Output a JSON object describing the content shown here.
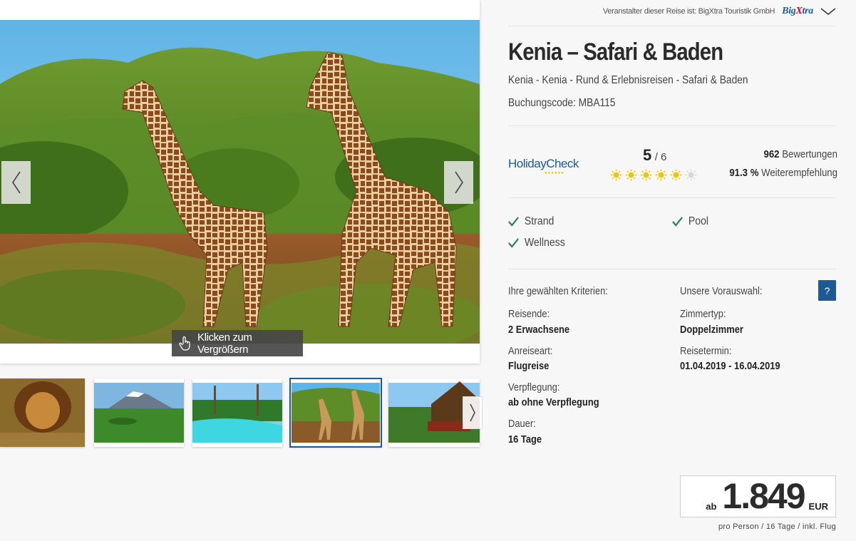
{
  "gallery": {
    "enlarge_label": "Klicken zum Vergrößern",
    "thumbnails": [
      {
        "name": "thumb-lion"
      },
      {
        "name": "thumb-kilimanjaro"
      },
      {
        "name": "thumb-pool"
      },
      {
        "name": "thumb-giraffes"
      },
      {
        "name": "thumb-lodge"
      }
    ],
    "active_thumbnail": 3
  },
  "operator": {
    "label": "Veranstalter dieser Reise ist: BigXtra Touristik GmbH",
    "logo_prefix": "Big",
    "logo_x": "X",
    "logo_suffix": "tra"
  },
  "offer": {
    "title": "Kenia – Safari & Baden",
    "breadcrumb": "Kenia - Kenia - Rund & Erlebnisreisen - Safari & Baden",
    "booking_code": "Buchungscode: MBA115"
  },
  "holidaycheck": {
    "logo_text": "HolidayCheck",
    "score": "5",
    "max": "/ 6",
    "suns_filled": 5,
    "suns_total": 6,
    "reviews_count": "962",
    "reviews_label": "Bewertungen",
    "recommend_pct": "91.3 %",
    "recommend_label": "Weiterempfehlung"
  },
  "features": [
    "Strand",
    "Pool",
    "Wellness"
  ],
  "criteria": {
    "left_heading": "Ihre gewählten Kriterien:",
    "right_heading": "Unsere Vorauswahl:",
    "help_label": "?",
    "travelers_label": "Reisende:",
    "travelers_value": "2 Erwachsene",
    "room_label": "Zimmertyp:",
    "room_value": "Doppelzimmer",
    "arrival_label": "Anreiseart:",
    "arrival_value": "Flugreise",
    "date_label": "Reisetermin:",
    "date_value": "01.04.2019 - 16.04.2019",
    "board_label": "Verpflegung:",
    "board_value": "ab ohne Verpflegung",
    "duration_label": "Dauer:",
    "duration_value": "16 Tage"
  },
  "price": {
    "prefix": "ab",
    "amount": "1.849",
    "currency": "EUR",
    "note": "pro Person / 16 Tage / inkl. Flug"
  },
  "colors": {
    "brand_blue": "#1d5a94",
    "check_green": "#2e7d5b",
    "sun_yellow": "#f5c400"
  }
}
